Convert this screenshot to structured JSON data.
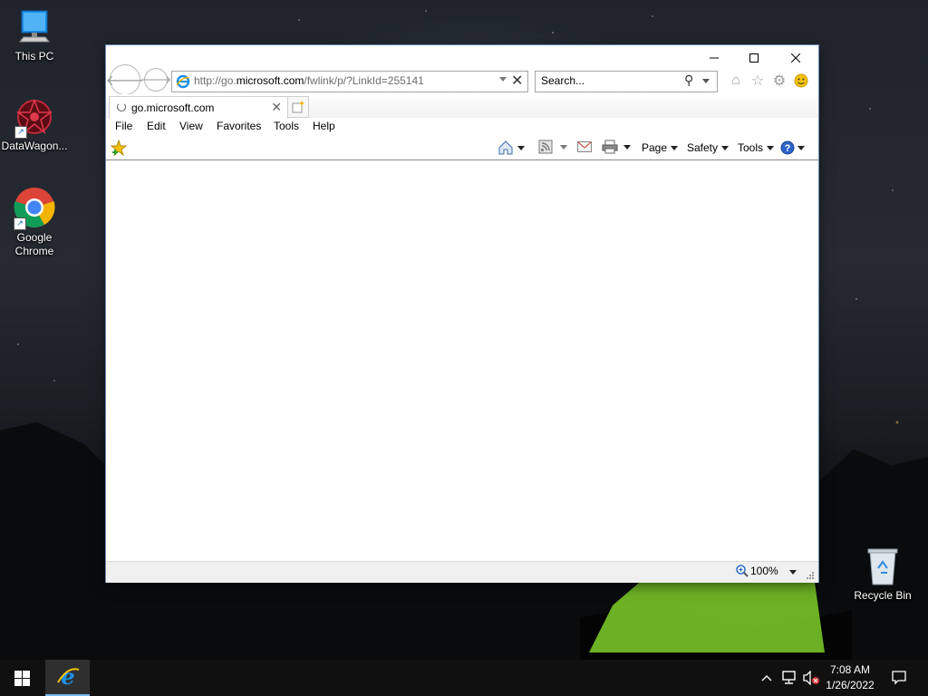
{
  "desktop": {
    "icons": [
      {
        "label": "This PC"
      },
      {
        "label": "DataWagon..."
      },
      {
        "label": "Google Chrome"
      },
      {
        "label": "Recycle Bin"
      }
    ]
  },
  "browser": {
    "address": {
      "prefix": "http://go.",
      "domain": "microsoft.com",
      "path": "/fwlink/p/?LinkId=255141"
    },
    "search_placeholder": "Search...",
    "tab": {
      "title": "go.microsoft.com"
    },
    "menu": [
      "File",
      "Edit",
      "View",
      "Favorites",
      "Tools",
      "Help"
    ],
    "commands": {
      "page": "Page",
      "safety": "Safety",
      "tools": "Tools"
    },
    "status": {
      "zoom": "100%"
    },
    "accent": "#1e6fd9"
  },
  "taskbar": {
    "time": "7:08 AM",
    "date": "1/26/2022"
  }
}
